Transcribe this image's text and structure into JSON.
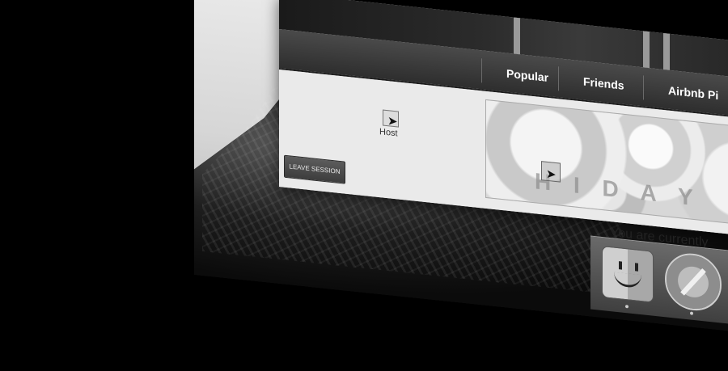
{
  "navbar": {
    "items": [
      {
        "label": "Popular"
      },
      {
        "label": "Friends"
      },
      {
        "label": "Airbnb Pi"
      }
    ]
  },
  "session": {
    "host_label": "Host",
    "leave_button": "LEAVE SESSION",
    "status_text": "You are currently"
  },
  "video": {
    "overlay_text": "H   I   D A Y"
  },
  "dock": {
    "apps": [
      "finder-icon",
      "safari-icon"
    ]
  }
}
